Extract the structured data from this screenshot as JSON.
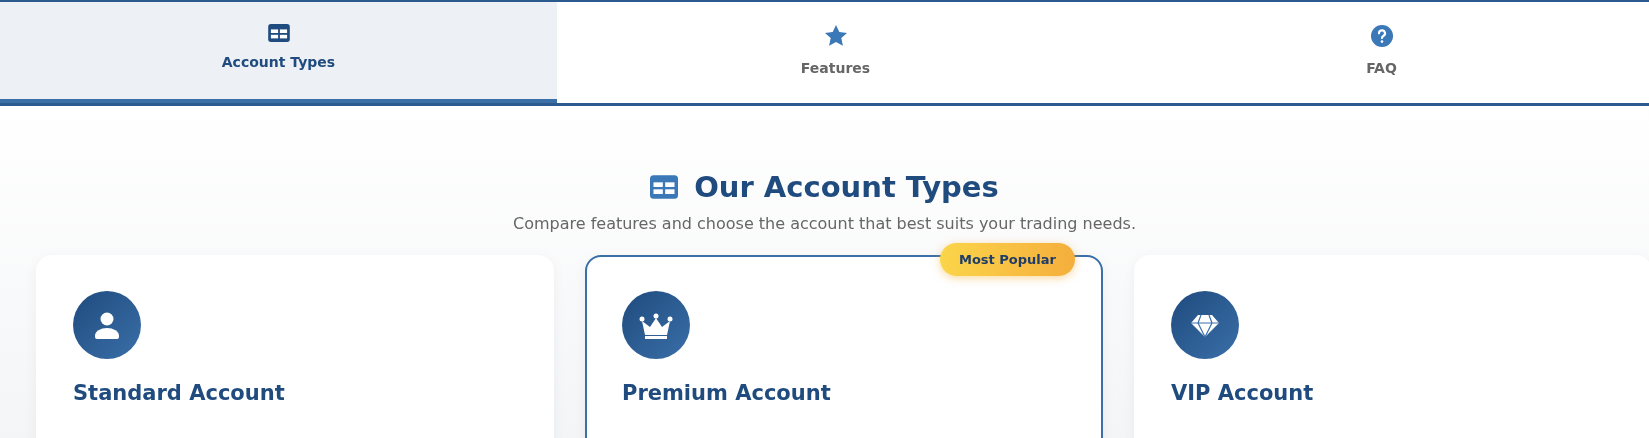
{
  "tabs": [
    {
      "label": "Account Types",
      "selected": true
    },
    {
      "label": "Features",
      "selected": false
    },
    {
      "label": "FAQ",
      "selected": false
    }
  ],
  "section": {
    "title": "Our Account Types",
    "subtitle": "Compare features and choose the account that best suits your trading needs."
  },
  "cards": [
    {
      "title": "Standard Account",
      "featured": false
    },
    {
      "title": "Premium Account",
      "featured": true,
      "badge": "Most Popular"
    },
    {
      "title": "VIP Account",
      "featured": false
    }
  ]
}
